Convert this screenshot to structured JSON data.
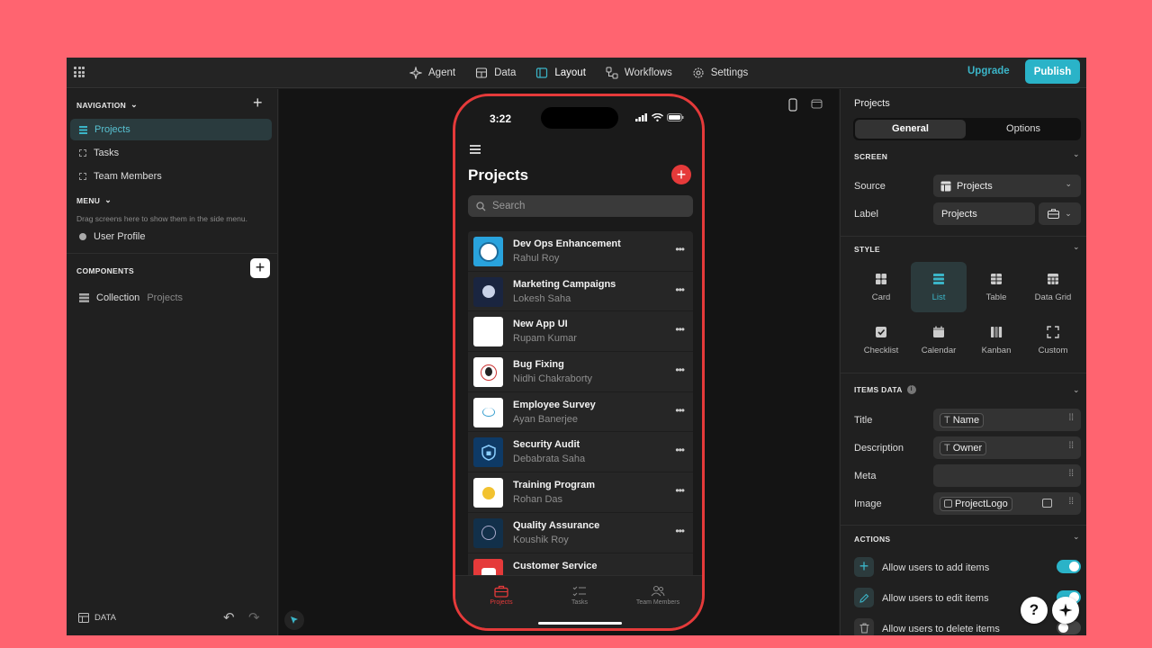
{
  "topbar": {
    "tabs": [
      {
        "label": "Agent",
        "icon": "sparkle-icon"
      },
      {
        "label": "Data",
        "icon": "table-icon"
      },
      {
        "label": "Layout",
        "icon": "layout-icon"
      },
      {
        "label": "Workflows",
        "icon": "workflow-icon"
      },
      {
        "label": "Settings",
        "icon": "gear-icon"
      }
    ],
    "active_tab": "Layout",
    "upgrade_label": "Upgrade",
    "publish_label": "Publish"
  },
  "left": {
    "navigation_title": "NAVIGATION",
    "nav_items": [
      "Projects",
      "Tasks",
      "Team Members"
    ],
    "menu_title": "MENU",
    "menu_hint": "Drag screens here to show them in the side menu.",
    "menu_item": "User Profile",
    "components_title": "COMPONENTS",
    "component": {
      "name": "Collection",
      "source": "Projects"
    },
    "data_label": "DATA"
  },
  "phone": {
    "time": "3:22",
    "title": "Projects",
    "search_placeholder": "Search",
    "items": [
      {
        "title": "Dev Ops Enhancement",
        "owner": "Rahul Roy"
      },
      {
        "title": "Marketing Campaigns",
        "owner": "Lokesh Saha"
      },
      {
        "title": "New App UI",
        "owner": "Rupam Kumar"
      },
      {
        "title": "Bug Fixing",
        "owner": "Nidhi Chakraborty"
      },
      {
        "title": "Employee Survey",
        "owner": "Ayan Banerjee"
      },
      {
        "title": "Security Audit",
        "owner": "Debabrata Saha"
      },
      {
        "title": "Training Program",
        "owner": "Rohan Das"
      },
      {
        "title": "Quality Assurance",
        "owner": "Koushik Roy"
      },
      {
        "title": "Customer Service",
        "owner": ""
      }
    ],
    "tabs": [
      "Projects",
      "Tasks",
      "Team Members"
    ]
  },
  "right": {
    "title": "Projects",
    "segments": [
      "General",
      "Options"
    ],
    "screen_title": "SCREEN",
    "source_label": "Source",
    "source_value": "Projects",
    "label_label": "Label",
    "label_value": "Projects",
    "style_title": "STYLE",
    "styles": [
      "Card",
      "List",
      "Table",
      "Data Grid",
      "Checklist",
      "Calendar",
      "Kanban",
      "Custom"
    ],
    "active_style": "List",
    "items_title": "ITEMS DATA",
    "fields": [
      {
        "label": "Title",
        "value": "Name"
      },
      {
        "label": "Description",
        "value": "Owner"
      },
      {
        "label": "Meta",
        "value": ""
      },
      {
        "label": "Image",
        "value": "ProjectLogo"
      }
    ],
    "actions_title": "ACTIONS",
    "actions": [
      {
        "label": "Allow users to add items",
        "on": true
      },
      {
        "label": "Allow users to edit items",
        "on": true
      },
      {
        "label": "Allow users to delete items",
        "on": false
      }
    ]
  },
  "colors": {
    "accent": "#2ab3c8",
    "brand_red": "#e53a3a",
    "background": "#ff6470"
  }
}
